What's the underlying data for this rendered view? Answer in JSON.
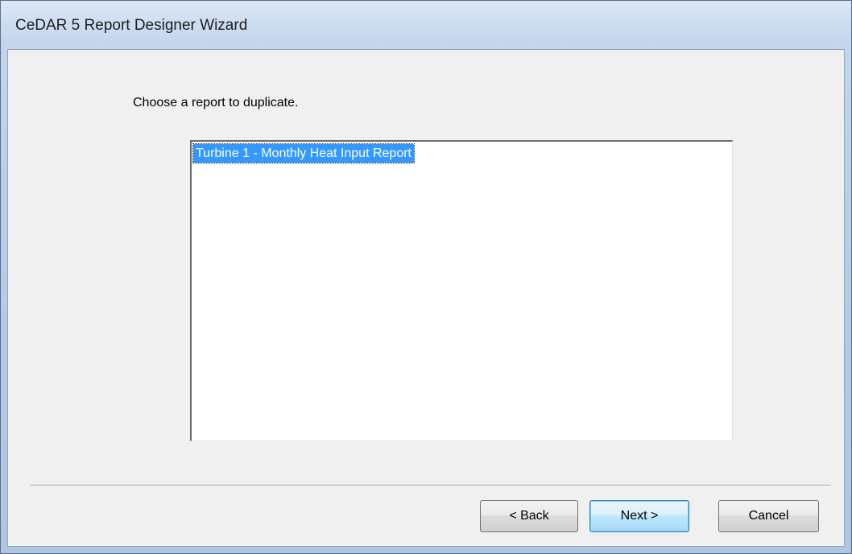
{
  "window": {
    "title": "CeDAR 5 Report Designer Wizard"
  },
  "wizard": {
    "prompt": "Choose a report to duplicate.",
    "reports": [
      {
        "label": "Turbine 1 - Monthly Heat Input Report",
        "selected": true
      }
    ]
  },
  "buttons": {
    "back": "< Back",
    "next": "Next >",
    "cancel": "Cancel"
  },
  "colors": {
    "selection": "#3399ff",
    "dialog_background": "#f0f0f0",
    "titlebar": "#cddcf0"
  }
}
